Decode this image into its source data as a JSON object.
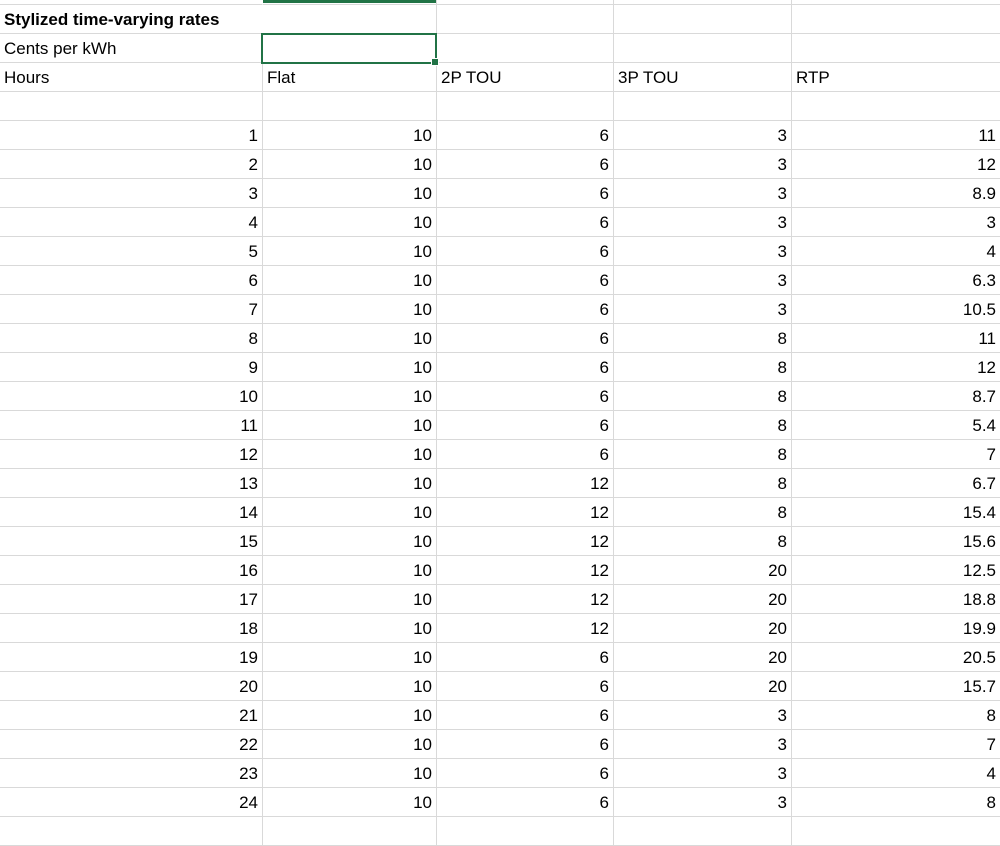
{
  "title_cell": "Stylized time-varying rates",
  "units_cell": "Cents per kWh",
  "headers": [
    "Hours",
    "Flat",
    "2P TOU",
    "3P TOU",
    "RTP"
  ],
  "rows": [
    [
      "1",
      "10",
      "6",
      "3",
      "11"
    ],
    [
      "2",
      "10",
      "6",
      "3",
      "12"
    ],
    [
      "3",
      "10",
      "6",
      "3",
      "8.9"
    ],
    [
      "4",
      "10",
      "6",
      "3",
      "3"
    ],
    [
      "5",
      "10",
      "6",
      "3",
      "4"
    ],
    [
      "6",
      "10",
      "6",
      "3",
      "6.3"
    ],
    [
      "7",
      "10",
      "6",
      "3",
      "10.5"
    ],
    [
      "8",
      "10",
      "6",
      "8",
      "11"
    ],
    [
      "9",
      "10",
      "6",
      "8",
      "12"
    ],
    [
      "10",
      "10",
      "6",
      "8",
      "8.7"
    ],
    [
      "11",
      "10",
      "6",
      "8",
      "5.4"
    ],
    [
      "12",
      "10",
      "6",
      "8",
      "7"
    ],
    [
      "13",
      "10",
      "12",
      "8",
      "6.7"
    ],
    [
      "14",
      "10",
      "12",
      "8",
      "15.4"
    ],
    [
      "15",
      "10",
      "12",
      "8",
      "15.6"
    ],
    [
      "16",
      "10",
      "12",
      "20",
      "12.5"
    ],
    [
      "17",
      "10",
      "12",
      "20",
      "18.8"
    ],
    [
      "18",
      "10",
      "12",
      "20",
      "19.9"
    ],
    [
      "19",
      "10",
      "6",
      "20",
      "20.5"
    ],
    [
      "20",
      "10",
      "6",
      "20",
      "15.7"
    ],
    [
      "21",
      "10",
      "6",
      "3",
      "8"
    ],
    [
      "22",
      "10",
      "6",
      "3",
      "7"
    ],
    [
      "23",
      "10",
      "6",
      "3",
      "4"
    ],
    [
      "24",
      "10",
      "6",
      "3",
      "8"
    ]
  ],
  "colors": {
    "selection": "#217346",
    "gridline": "#d9d9d9"
  }
}
